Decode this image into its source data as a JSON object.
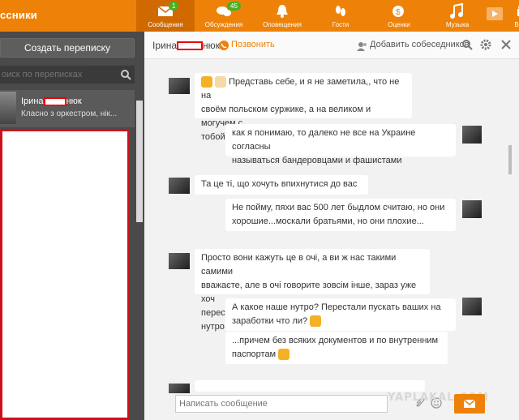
{
  "app": {
    "brand": "ссники"
  },
  "nav": [
    {
      "label": "Сообщения",
      "icon": "envelope-icon",
      "badge": "1",
      "active": true
    },
    {
      "label": "Обсуждения",
      "icon": "chat-bubbles-icon",
      "badge": "45"
    },
    {
      "label": "Оповещения",
      "icon": "bell-icon"
    },
    {
      "label": "Гости",
      "icon": "footprints-icon"
    },
    {
      "label": "Оценки",
      "icon": "rating-icon"
    },
    {
      "label": "Музыка",
      "icon": "music-note-icon"
    },
    {
      "label": "Видео",
      "icon": "video-camera-icon"
    }
  ],
  "left": {
    "create_label": "Создать переписку",
    "search_placeholder": "оиск по переписках",
    "conversation": {
      "name_start": "Ірина",
      "name_end": "нюк",
      "preview": "Класно з оркестром, нік..."
    }
  },
  "chat": {
    "contact_start": "Ірина",
    "contact_end": "нюк",
    "call_label": "Позвонить",
    "add_label": "Добавить собеседников",
    "compose_placeholder": "Написать сообщение",
    "watermark": "YAPLAKAL.COM",
    "messages": [
      {
        "side": "left",
        "line1": "Представь себе, и я не заметила,, что не на",
        "line2": "своём польском суржике, а на великом и могучем с",
        "line3": "тобой общаюсь"
      },
      {
        "side": "right",
        "line1": "как я понимаю, то далеко не все на Украине согласны",
        "line2": "называться бандеровцами и фашистами"
      },
      {
        "side": "left",
        "line1": "Та це ті, що хочуть впихнутися до вас"
      },
      {
        "side": "right",
        "line1": "Не пойму, пяхи вас 500 лет быдлом считаю, но они",
        "line2": "хорошие...москали братьями, но они плохие..."
      },
      {
        "side": "left",
        "line1": "Просто вони кажуть це в очі, а ви ж нас такими самими",
        "line2": "вважаєте, але в очі говорите зовсім інше, зараз уже хоч",
        "line3": "перестали лицемірити і відкрили мені очі на ваше нутро"
      },
      {
        "side": "right",
        "line1": "А какое наше нутро? Перестали пускать ваших на",
        "line2": "заработки что ли?"
      },
      {
        "side": "right",
        "line1": "...причем без всяких документов и по внутренним",
        "line2": "паспортам"
      }
    ]
  }
}
